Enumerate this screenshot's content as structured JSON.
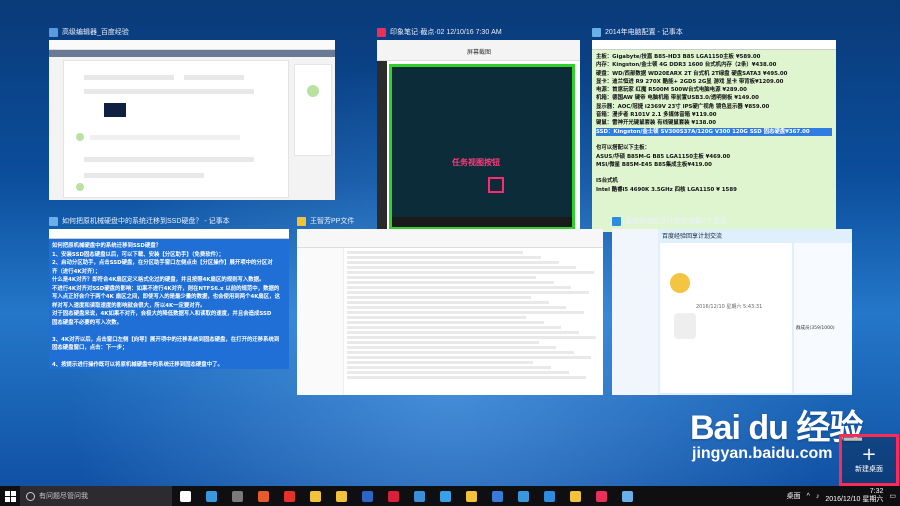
{
  "windows": [
    {
      "title": "高级编辑器_百度经验",
      "icon_color": "#5a9be0"
    },
    {
      "title": "印象笔记·截点·02 12/10/16 7:30 AM",
      "icon_color": "#e8305a"
    },
    {
      "title": "2014年电脑配置 - 记事本",
      "icon_color": "#6ab0e8"
    },
    {
      "title": "如何把原机械硬盘中的系统迁移到SSD硬盘？ - 记事本",
      "icon_color": "#6ab0e8"
    },
    {
      "title": "王智芳PP文件",
      "icon_color": "#f2c23a"
    },
    {
      "title": "百度经验回享计划交流群2个会话",
      "icon_color": "#2d8ce0"
    }
  ],
  "snip": {
    "annotation": "任务视图按钮",
    "toolbar_label": "屏幕截图"
  },
  "notepad_config": {
    "lines": [
      "主板：Gigabyte/技嘉 B85-HD3 B85 LGA1150主板 ¥589.00",
      "内存：Kingston/金士顿 4G DDR3 1600 台式机内存（2条）¥438.00",
      "硬盘：WD/西部数据 WD20EARX 2T 台式机 2T绿盘 硬盘SATA3 ¥495.00",
      "显卡：迪兰恒进 R9 270X 酷能+ 2GD5 2G显 游戏 显卡 带背板¥1209.00",
      "电源：首席玩家 红魔 R500M 500W台式电脑电源 ¥289.00",
      "机箱：德国AW 键帝 电脑机箱 带前置USB3.0/透明侧板 ¥149.00",
      "显示器：AOC/冠捷 i2369V 23寸 IPS硬广视角 镜色显示器 ¥859.00",
      "音箱：漫步者 R101V 2.1 多媒体音箱 ¥119.00",
      "键鼠：雷神开光键鼠套装 有线键鼠套装 ¥138.00",
      "SSD：Kingston/金士顿 SV300S37A/120G V300 120G SSD 固态硬盘¥367.00",
      "",
      "也可以搭配以下主板：",
      "    ASUS/华硕 B85M-G B85 LGA1150主板 ¥469.00",
      "    MSI/微星 B85M-E45 B85集成主板¥419.00",
      "",
      "I5台式机",
      "Intel 酷睿i5 4690K 3.5GHz 四核 LGA1150 ¥ 1589"
    ],
    "highlight_index": 9
  },
  "notepad_ssd": {
    "lines": [
      "如何把原机械硬盘中的系统迁移到SSD硬盘？",
      "1、安装SSD固态硬盘以后，可以下载、安装【分区助手】（免费软件）；",
      "2、启动分区助手，点击SSD硬盘，在分区助手窗口左侧点击【分区操作】展开项中的分区对",
      "齐（进行4K对齐）；",
      "什么是4K对齐？即符合4K扇区定义格式化过的硬盘，并且按照4K扇区的规则写入数据。",
      "不进行4K对齐对SSD硬盘的影响：如果不进行4K对齐，则在NTFS6.x 以前的规范中，数据的",
      "写入点正好会介于两个4K 扇区之间，即使写入的是最少量的数据，也会使用到两个4K扇区，这",
      "样对写入速度和读取速度的影响就会很大，所以4K一定要对齐。",
      "对于固态硬盘来说，4K如果不对齐，会极大的降低数据写入和读取的速度，并且会造成SSD",
      "固态硬盘不必要的写入次数。",
      "",
      "3、4K对齐以后，点击窗口左侧【向导】展开项中的迁移系统到固态硬盘，在打开的迁移系统到",
      "固态硬盘窗口，点击：下一步；",
      "",
      "4、按提示进行操作既可以将原机械硬盘中的系统迁移到固态硬盘中了。"
    ]
  },
  "qq": {
    "group_name": "百度经验回享计划交流",
    "time_label": "2016/12/10 星期六 5:43:31",
    "members_label": "群成员(359/1000)"
  },
  "new_desktop": {
    "label": "新建桌面"
  },
  "watermark": {
    "brand": "Bai du 经验",
    "url": "jingyan.baidu.com"
  },
  "taskbar": {
    "search_placeholder": "有问题尽管问我",
    "apps": [
      {
        "name": "task-view-icon",
        "color": "#ffffff"
      },
      {
        "name": "edge-icon",
        "color": "#3a96dd"
      },
      {
        "name": "calculator-icon",
        "color": "#7a7a7a"
      },
      {
        "name": "notes-icon",
        "color": "#e85a2a"
      },
      {
        "name": "block-icon",
        "color": "#e8302a"
      },
      {
        "name": "folder-icon",
        "color": "#f2c23a"
      },
      {
        "name": "folder2-icon",
        "color": "#f2c23a"
      },
      {
        "name": "word-icon",
        "color": "#2b65c8"
      },
      {
        "name": "red-app-icon",
        "color": "#d8203a"
      },
      {
        "name": "chrome-icon",
        "color": "#3a8fd8"
      },
      {
        "name": "ie-icon",
        "color": "#3aa0e8"
      },
      {
        "name": "explorer-icon",
        "color": "#f2c23a"
      },
      {
        "name": "store-icon",
        "color": "#3a7ad8"
      },
      {
        "name": "mail-icon",
        "color": "#3a96dd"
      },
      {
        "name": "media-icon",
        "color": "#2d8ce0"
      },
      {
        "name": "qq-icon",
        "color": "#f2c23a"
      },
      {
        "name": "evernote-icon",
        "color": "#e8305a"
      },
      {
        "name": "notepad-icon",
        "color": "#6ab0e8"
      }
    ],
    "desktop_label": "桌面",
    "time": "7:32",
    "date": "2016/12/10 星期六"
  }
}
